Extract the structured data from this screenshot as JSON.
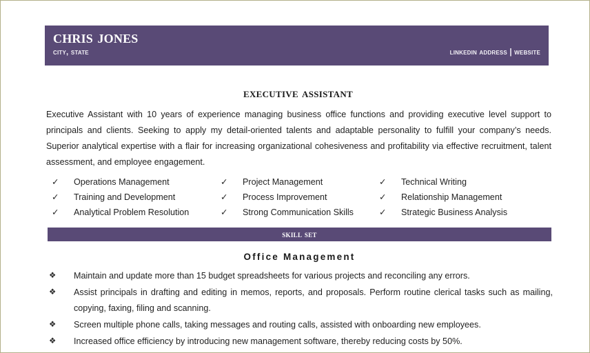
{
  "document": {
    "type": "resume",
    "accent_color": "#594A76",
    "border_color": "#b3b08a",
    "text_color": "#1f1f1f"
  },
  "header": {
    "name": "Chris Jones",
    "location": "City, State",
    "links": "LinkedIn Address | Website"
  },
  "job_title": "Executive Assistant",
  "summary": "Executive Assistant with 10 years of experience managing business office functions and providing executive level support to principals and clients. Seeking to apply my detail-oriented talents and adaptable personality to fulfill your company’s needs. Superior analytical expertise with a flair for increasing organizational cohesiveness and profitability via effective recruitment, talent assessment, and employee engagement.",
  "skills": {
    "check_mark": "✓",
    "columns": [
      [
        "Operations Management",
        "Training and Development",
        "Analytical Problem Resolution"
      ],
      [
        "Project Management",
        "Process Improvement",
        "Strong Communication Skills"
      ],
      [
        "Technical Writing",
        "Relationship Management",
        "Strategic Business Analysis"
      ]
    ]
  },
  "section": {
    "bar_title": "Skill set",
    "sub_heading": "Office Management",
    "bullet_mark": "❖",
    "bullets": [
      "Maintain and update more than 15 budget spreadsheets for various projects and reconciling any errors.",
      "Assist principals in drafting and editing in memos, reports, and proposals. Perform routine clerical tasks such as mailing, copying, faxing, filing and scanning.",
      "Screen multiple phone calls, taking messages and routing calls, assisted with onboarding new employees.",
      "Increased office efficiency by introducing new management software, thereby reducing costs by 50%."
    ]
  }
}
